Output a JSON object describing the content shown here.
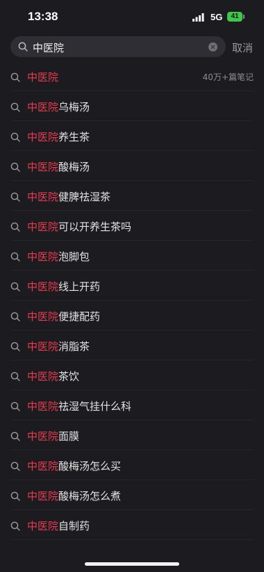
{
  "status_bar": {
    "time": "13:38",
    "network": "5G",
    "battery": "41"
  },
  "search": {
    "query": "中医院",
    "cancel_label": "取消"
  },
  "suggestions": [
    {
      "highlight": "中医院",
      "rest": "",
      "meta": "40万+篇笔记"
    },
    {
      "highlight": "中医院",
      "rest": "乌梅汤"
    },
    {
      "highlight": "中医院",
      "rest": "养生茶"
    },
    {
      "highlight": "中医院",
      "rest": "酸梅汤"
    },
    {
      "highlight": "中医院",
      "rest": "健脾祛湿茶"
    },
    {
      "highlight": "中医院",
      "rest": "可以开养生茶吗"
    },
    {
      "highlight": "中医院",
      "rest": "泡脚包"
    },
    {
      "highlight": "中医院",
      "rest": "线上开药"
    },
    {
      "highlight": "中医院",
      "rest": "便捷配药"
    },
    {
      "highlight": "中医院",
      "rest": "消脂茶"
    },
    {
      "highlight": "中医院",
      "rest": "茶饮"
    },
    {
      "highlight": "中医院",
      "rest": "祛湿气挂什么科"
    },
    {
      "highlight": "中医院",
      "rest": "面膜"
    },
    {
      "highlight": "中医院",
      "rest": "酸梅汤怎么买"
    },
    {
      "highlight": "中医院",
      "rest": "酸梅汤怎么煮"
    },
    {
      "highlight": "中医院",
      "rest": "自制药"
    }
  ]
}
